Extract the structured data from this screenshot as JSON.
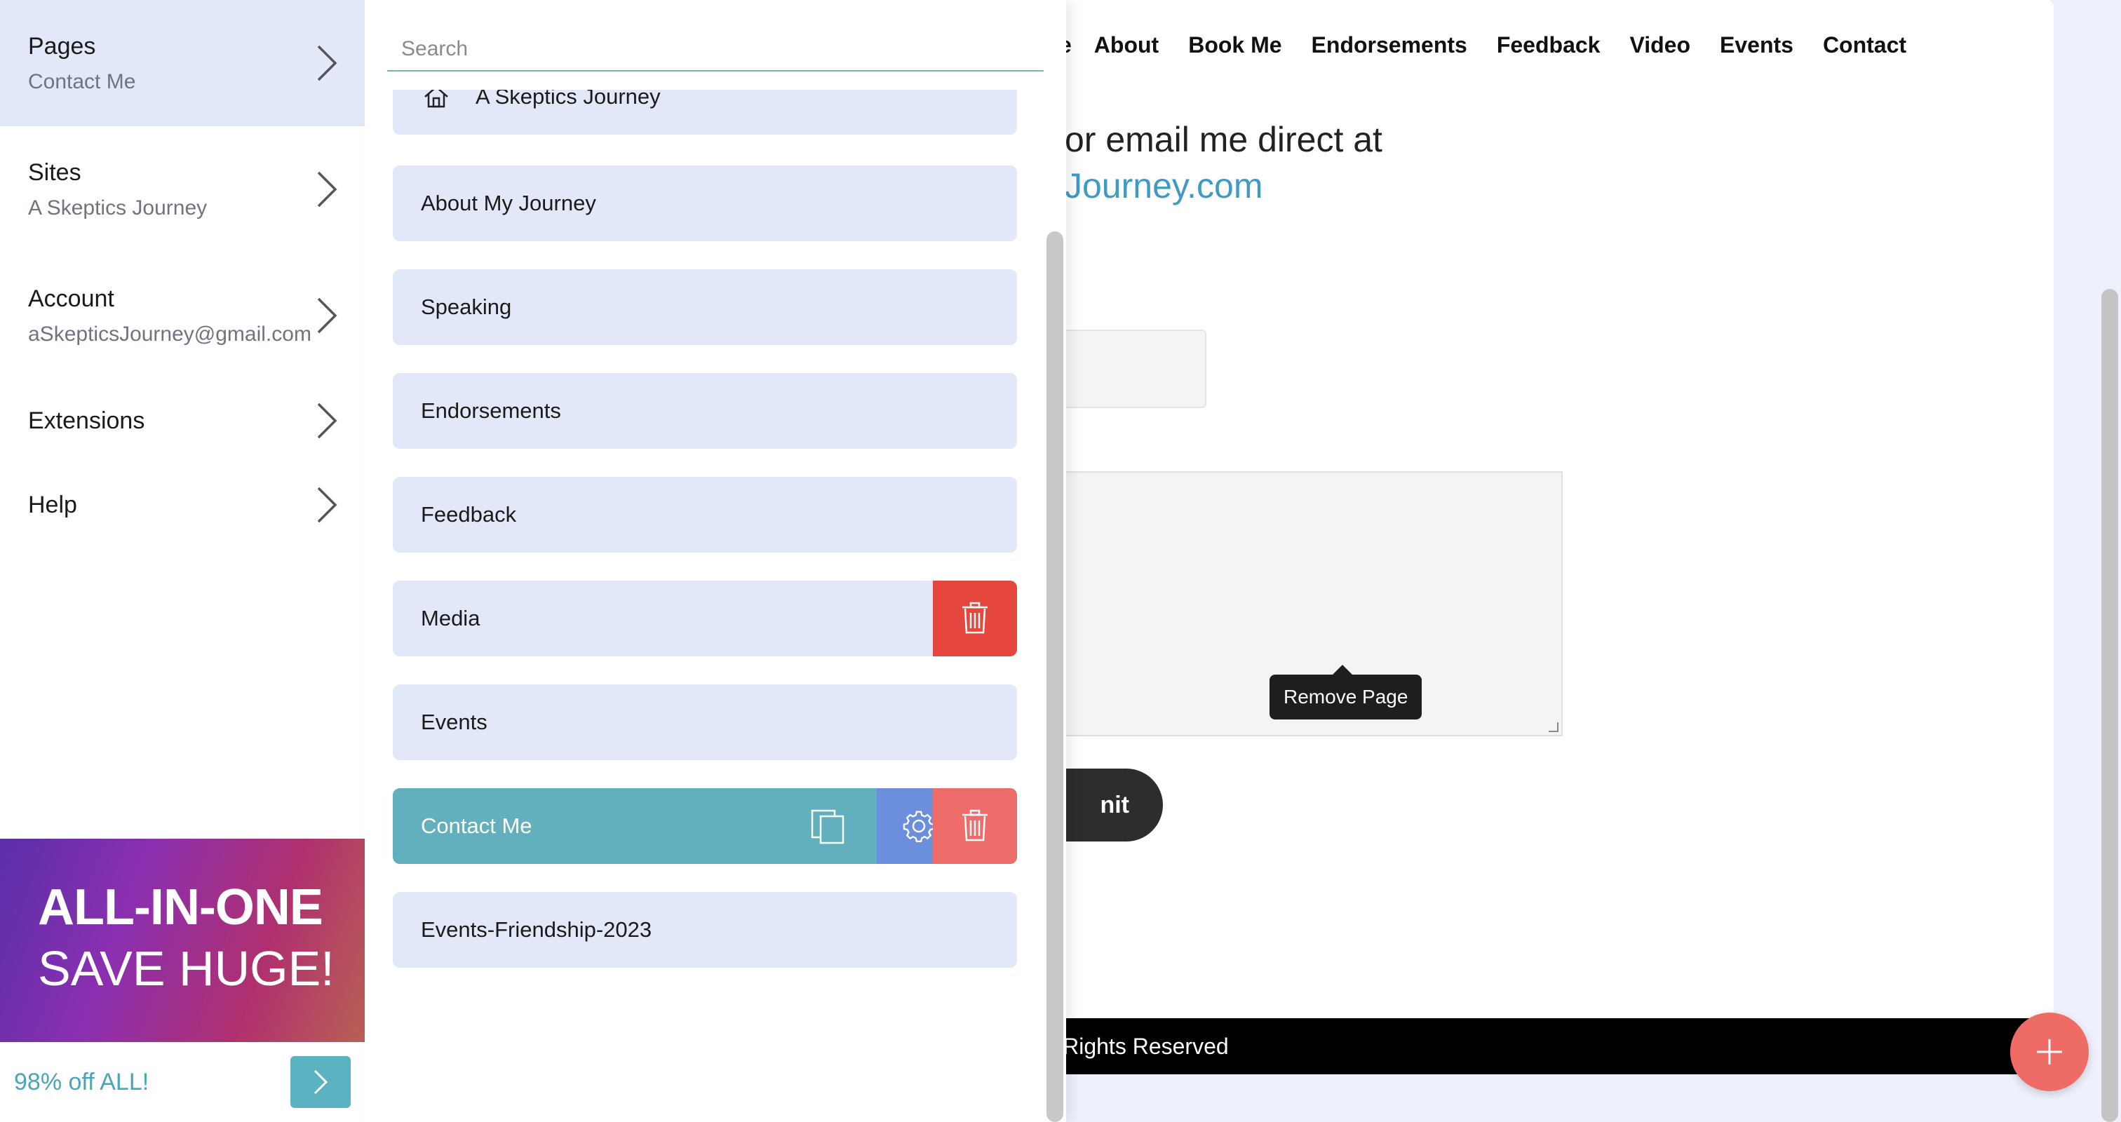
{
  "left_nav": {
    "sections": [
      {
        "title": "Pages",
        "subtitle": "Contact Me"
      },
      {
        "title": "Sites",
        "subtitle": "A Skeptics Journey"
      },
      {
        "title": "Account",
        "subtitle": "aSkepticsJourney@gmail.com"
      },
      {
        "title": "Extensions"
      },
      {
        "title": "Help"
      }
    ],
    "promo": {
      "line1": "ALL-IN-ONE",
      "line2": "SAVE HUGE!",
      "offer": "98% off ALL!"
    }
  },
  "pages_panel": {
    "search": {
      "placeholder": "Search",
      "value": ""
    },
    "pages": [
      {
        "label": "A Skeptics Journey",
        "icon": "home-icon"
      },
      {
        "label": "About My Journey"
      },
      {
        "label": "Speaking"
      },
      {
        "label": "Endorsements"
      },
      {
        "label": "Feedback"
      },
      {
        "label": "Media"
      },
      {
        "label": "Events"
      },
      {
        "label": "Contact Me"
      },
      {
        "label": "Events-Friendship-2023"
      }
    ],
    "tooltip": "Remove Page",
    "colors": {
      "selected": "#62b0bd",
      "danger": "#e5473f",
      "settings": "#6b8fdd",
      "item_bg": "#e3e8f8"
    }
  },
  "site_preview": {
    "nav": {
      "home_fragment": "e",
      "items": [
        "About",
        "Book Me",
        "Endorsements",
        "Feedback",
        "Video",
        "Events",
        "Contact"
      ]
    },
    "contact_line": "or email me direct at",
    "email_fragment": "Journey.com",
    "submit_fragment": "nit",
    "footer_fragment": "ll Rights Reserved"
  }
}
